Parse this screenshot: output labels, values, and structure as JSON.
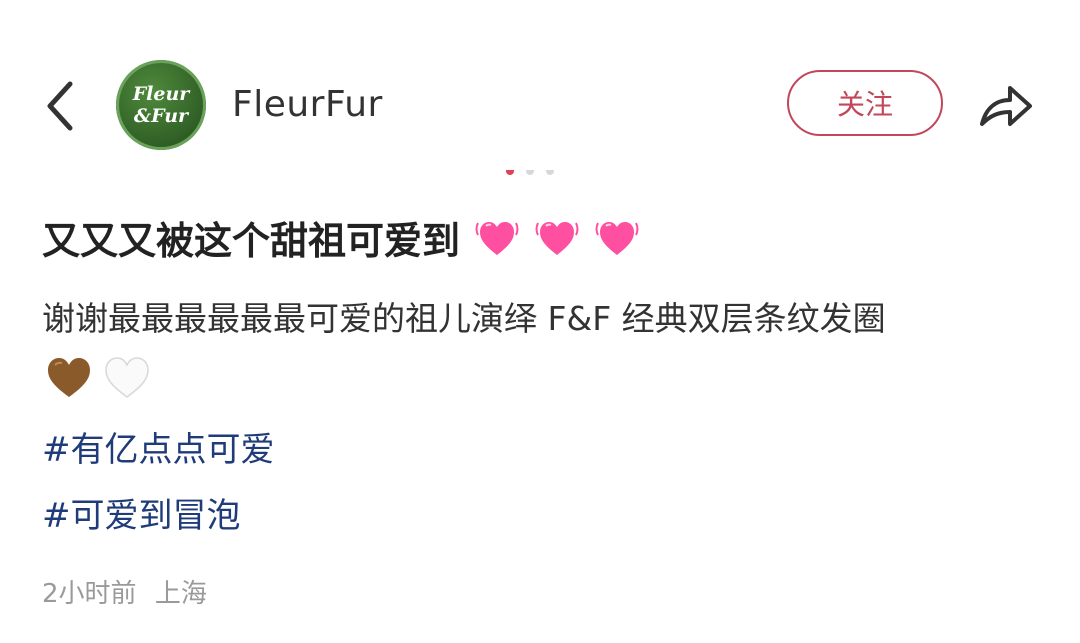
{
  "header": {
    "username": "FleurFur",
    "avatar_text_line1": "Fleur",
    "avatar_text_line2": "&Fur",
    "follow_label": "关注"
  },
  "carousel": {
    "total": 3,
    "active": 0,
    "active_color": "#e0405a",
    "inactive_color": "#d8d8d8"
  },
  "post": {
    "title": "又又又被这个甜祖可爱到",
    "title_icons": [
      "vibrating-heart-icon",
      "vibrating-heart-icon",
      "vibrating-heart-icon"
    ],
    "description": "谢谢最最最最最最可爱的祖儿演绎 F&F 经典双层条纹发圈",
    "description_icons": [
      "brown-heart-icon",
      "white-heart-icon"
    ],
    "tags": [
      "#有亿点点可爱",
      "#可爱到冒泡"
    ],
    "time": "2小时前",
    "location": "上海"
  },
  "colors": {
    "accent": "#c2475a",
    "tag": "#1f3b7a",
    "heart_pink": "#ff4fa0",
    "heart_brown": "#8b5a2b"
  }
}
